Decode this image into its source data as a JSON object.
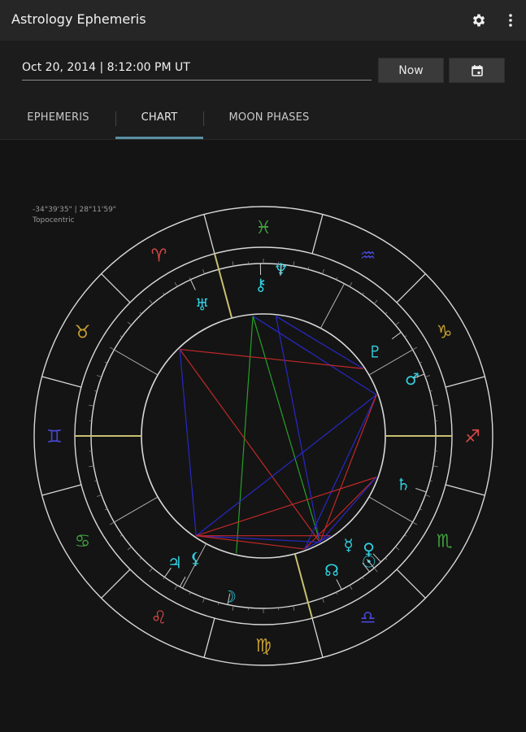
{
  "app": {
    "title": "Astrology Ephemeris",
    "settings_icon": "gear-icon",
    "overflow_icon": "more-vert-icon"
  },
  "toolbar": {
    "date_value": "Oct 20, 2014 | 8:12:00 PM UT",
    "now_label": "Now",
    "calendar_icon": "calendar-icon"
  },
  "tabs": [
    {
      "label": "EPHEMERIS",
      "active": false
    },
    {
      "label": "CHART",
      "active": true
    },
    {
      "label": "MOON PHASES",
      "active": false
    }
  ],
  "chart": {
    "coords_line": "-34°39'35\" | 28°11'59\"",
    "mode_line": "Topocentric",
    "colors": {
      "ring": "#d8d8d8",
      "fire": "#d84848",
      "earth": "#c8a030",
      "air": "#4848d8",
      "water": "#40a040",
      "planet": "#30d0e0",
      "axis": "#c8c070",
      "aspect_red": "#c02828",
      "aspect_blue": "#2828c8",
      "aspect_green": "#28a028"
    },
    "signs": [
      {
        "glyph": "♈",
        "name": "aries",
        "color": "fire"
      },
      {
        "glyph": "♉",
        "name": "taurus",
        "color": "earth"
      },
      {
        "glyph": "♊",
        "name": "gemini",
        "color": "air"
      },
      {
        "glyph": "♋",
        "name": "cancer",
        "color": "water"
      },
      {
        "glyph": "♌",
        "name": "leo",
        "color": "fire"
      },
      {
        "glyph": "♍",
        "name": "virgo",
        "color": "earth"
      },
      {
        "glyph": "♎",
        "name": "libra",
        "color": "air"
      },
      {
        "glyph": "♏",
        "name": "scorpio",
        "color": "water"
      },
      {
        "glyph": "♐",
        "name": "sagittarius",
        "color": "fire"
      },
      {
        "glyph": "♑",
        "name": "capricorn",
        "color": "earth"
      },
      {
        "glyph": "♒",
        "name": "aquarius",
        "color": "air"
      },
      {
        "glyph": "♓",
        "name": "pisces",
        "color": "water"
      }
    ],
    "planets": [
      {
        "glyph": "♅",
        "name": "uranus"
      },
      {
        "glyph": "⚷",
        "name": "chiron"
      },
      {
        "glyph": "♆",
        "name": "neptune"
      },
      {
        "glyph": "♇",
        "name": "pluto"
      },
      {
        "glyph": "♂",
        "name": "mars"
      },
      {
        "glyph": "♄",
        "name": "saturn"
      },
      {
        "glyph": "♀",
        "name": "venus"
      },
      {
        "glyph": "☿",
        "name": "mercury"
      },
      {
        "glyph": "☉",
        "name": "sun"
      },
      {
        "glyph": "☊",
        "name": "north-node"
      },
      {
        "glyph": "☽",
        "name": "moon"
      },
      {
        "glyph": "♃",
        "name": "jupiter"
      },
      {
        "glyph": "⚸",
        "name": "lilith"
      }
    ]
  }
}
